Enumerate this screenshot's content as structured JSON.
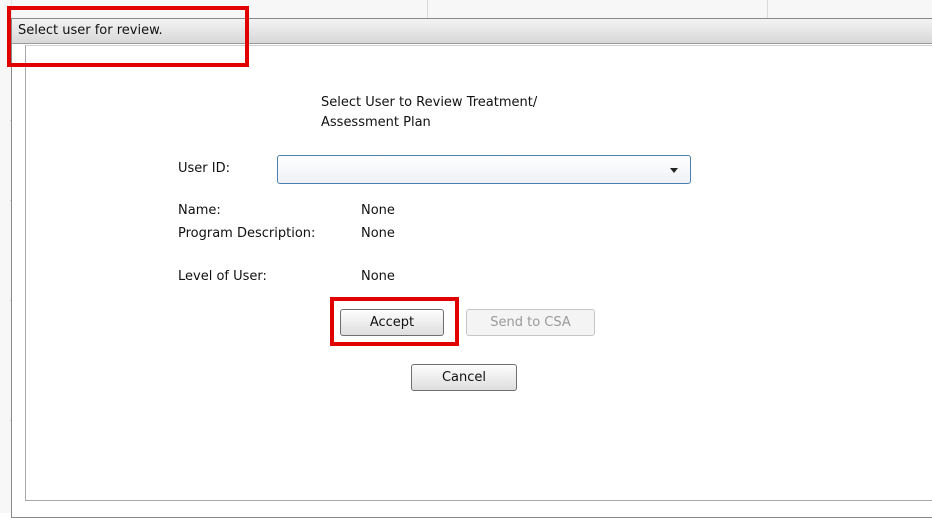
{
  "dialog": {
    "title": "Select user for review."
  },
  "form": {
    "heading_line1": "Select User to Review Treatment/",
    "heading_line2": "Assessment Plan",
    "user_id_label": "User ID:",
    "user_id_value": "",
    "name_label": "Name:",
    "name_value": "None",
    "program_label": "Program Description:",
    "program_value": "None",
    "level_label": "Level of User:",
    "level_value": "None"
  },
  "buttons": {
    "accept": "Accept",
    "send_to_csa": "Send to CSA",
    "cancel": "Cancel"
  },
  "annotations": {
    "highlight_color": "#e00000"
  }
}
